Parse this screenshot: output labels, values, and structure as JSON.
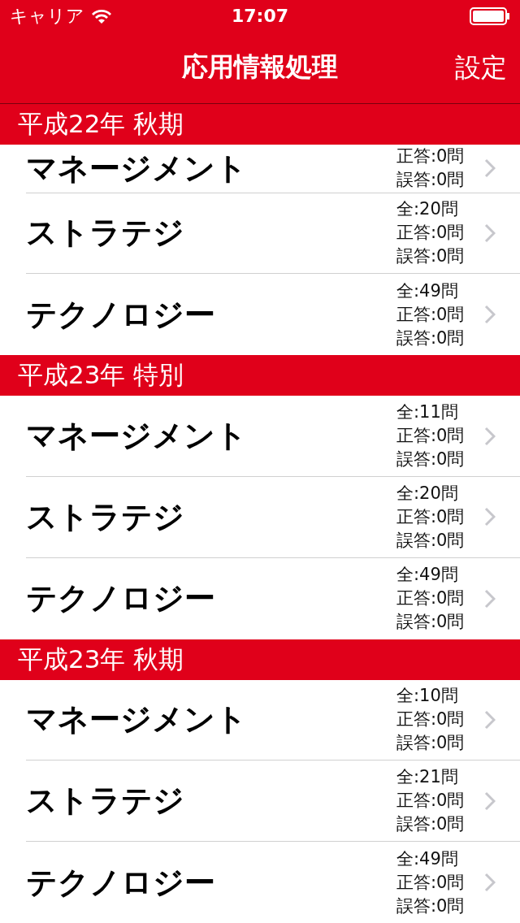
{
  "status_bar": {
    "carrier": "キャリア",
    "time": "17:07"
  },
  "nav": {
    "title": "応用情報処理",
    "right_button": "設定"
  },
  "sections": [
    {
      "header": "平成22年 秋期",
      "rows": [
        {
          "title": "マネージメント",
          "stats": [
            "正答:0問",
            "誤答:0問"
          ]
        },
        {
          "title": "ストラテジ",
          "stats": [
            "全:20問",
            "正答:0問",
            "誤答:0問"
          ]
        },
        {
          "title": "テクノロジー",
          "stats": [
            "全:49問",
            "正答:0問",
            "誤答:0問"
          ]
        }
      ]
    },
    {
      "header": "平成23年 特別",
      "rows": [
        {
          "title": "マネージメント",
          "stats": [
            "全:11問",
            "正答:0問",
            "誤答:0問"
          ]
        },
        {
          "title": "ストラテジ",
          "stats": [
            "全:20問",
            "正答:0問",
            "誤答:0問"
          ]
        },
        {
          "title": "テクノロジー",
          "stats": [
            "全:49問",
            "正答:0問",
            "誤答:0問"
          ]
        }
      ]
    },
    {
      "header": "平成23年 秋期",
      "rows": [
        {
          "title": "マネージメント",
          "stats": [
            "全:10問",
            "正答:0問",
            "誤答:0問"
          ]
        },
        {
          "title": "ストラテジ",
          "stats": [
            "全:21問",
            "正答:0問",
            "誤答:0問"
          ]
        },
        {
          "title": "テクノロジー",
          "stats": [
            "全:49問",
            "正答:0問",
            "誤答:0問"
          ]
        }
      ]
    }
  ]
}
